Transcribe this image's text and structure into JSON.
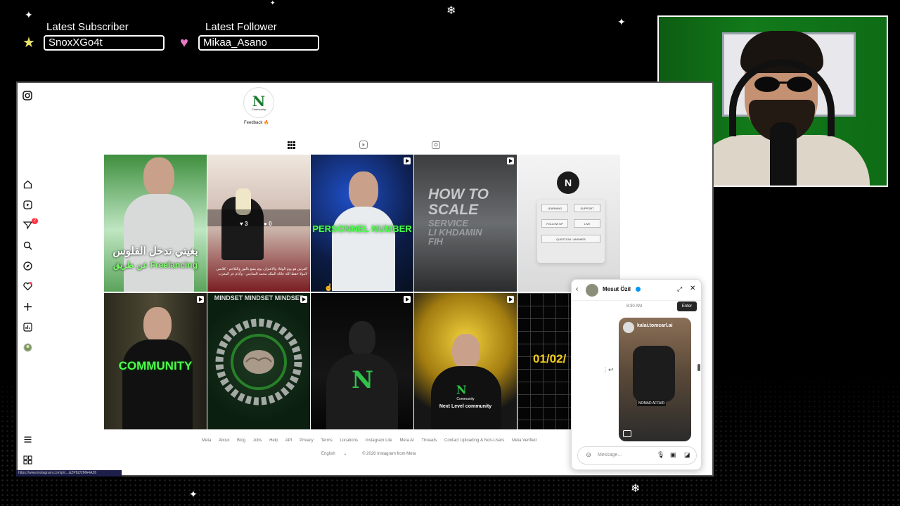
{
  "overlay": {
    "latest_subscriber": {
      "title": "Latest Subscriber",
      "value": "SnoxXGo4t"
    },
    "latest_follower": {
      "title": "Latest Follower",
      "value": "Mikaa_Asano"
    }
  },
  "instagram": {
    "profile": {
      "logo_letter": "N",
      "logo_caption": "Community",
      "feedback_text": "Feedback 🔥"
    },
    "sidebar": [
      "instagram-logo",
      "home",
      "reels",
      "messages",
      "search",
      "explore",
      "notifications",
      "create",
      "dashboard",
      "profile",
      "more",
      "also-from-meta"
    ],
    "messages_badge": "2",
    "tabs": [
      "posts",
      "reels",
      "tagged"
    ],
    "posts": [
      {
        "name": "post-freelancing",
        "text_lines": [
          "بغيتي تدخل الفلوس",
          "عن طريق Freelancing"
        ]
      },
      {
        "name": "post-horse",
        "likes": "3",
        "comments": "0",
        "caption": "العرش هو يوم الوفاء والاعتزاز، يوم يشع بالنور والتلاحم · كلاسي لامولا حفظ الله جلالة الملك محمد السادس · وأدام عز المغرب"
      },
      {
        "name": "post-personnel-number",
        "text": "PERSONNEL NUMBER"
      },
      {
        "name": "post-how-to-scale",
        "text_lines": [
          "HOW TO",
          "SCALE",
          "SERVICE",
          "LI KHDAMIN",
          "FIH"
        ]
      },
      {
        "name": "post-community-menu",
        "buttons": [
          "LEARNING",
          "SUPPORT",
          "FOLLOW UP",
          "LIVE",
          "QUESTION / ANSWER"
        ]
      },
      {
        "name": "post-community",
        "text": "COMMUNITY"
      },
      {
        "name": "post-mindset",
        "text": "MINDSET MINDSET MINDSET"
      },
      {
        "name": "post-silhouette",
        "text": ""
      },
      {
        "name": "post-next-level",
        "text_lines": [
          "Community",
          "Next Level community"
        ]
      },
      {
        "name": "post-date",
        "text": "01/02/"
      }
    ],
    "footer_links": [
      "Meta",
      "About",
      "Blog",
      "Jobs",
      "Help",
      "API",
      "Privacy",
      "Terms",
      "Locations",
      "Instagram Lite",
      "Meta AI",
      "Threads",
      "Contact Uploading & Non-Users",
      "Meta Verified"
    ],
    "footer_language": "English",
    "footer_copyright": "© 2026 Instagram from Meta"
  },
  "chat": {
    "contact_name": "Mesut Özil",
    "time": "8:30 AM",
    "tooltip": "Enter",
    "shared_post": {
      "username": "kalai.tomcarl.ai",
      "caption": "NOMAD AFFAIR"
    },
    "input_placeholder": "Message..."
  },
  "status_url": "https://www.instagram.com/p/c...&ZP8Z/2MA4AZ6"
}
